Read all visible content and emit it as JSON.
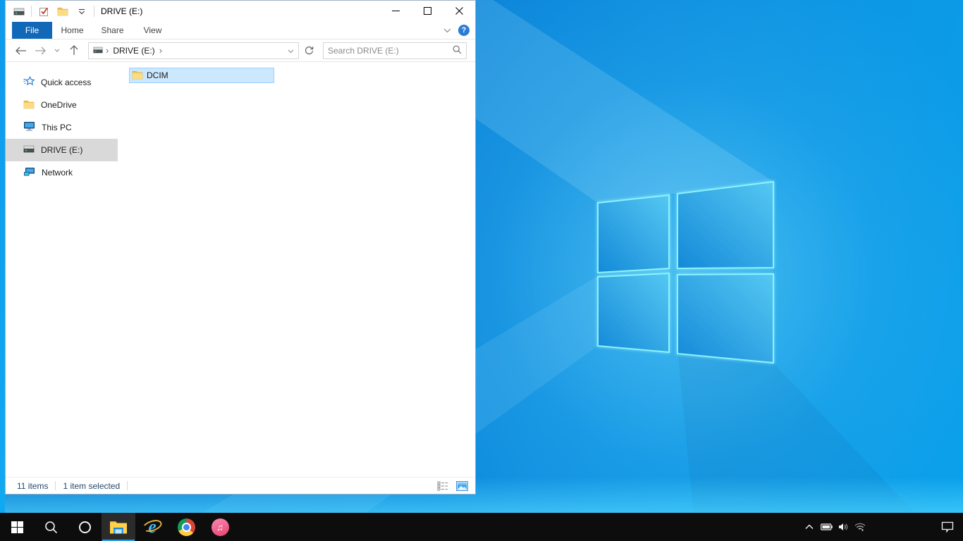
{
  "explorer": {
    "title": "DRIVE (E:)",
    "ribbon_tabs": [
      {
        "label": "File",
        "active": true
      },
      {
        "label": "Home",
        "active": false
      },
      {
        "label": "Share",
        "active": false
      },
      {
        "label": "View",
        "active": false
      }
    ],
    "breadcrumb": {
      "root_icon": "drive-icon",
      "segments": [
        "DRIVE (E:)"
      ]
    },
    "search_placeholder": "Search DRIVE (E:)",
    "sidebar_items": [
      {
        "label": "Quick access",
        "icon": "quick-access-star-icon",
        "selected": false
      },
      {
        "label": "OneDrive",
        "icon": "folder-icon",
        "selected": false
      },
      {
        "label": "This PC",
        "icon": "this-pc-icon",
        "selected": false
      },
      {
        "label": "DRIVE (E:)",
        "icon": "drive-icon",
        "selected": true
      },
      {
        "label": "Network",
        "icon": "network-icon",
        "selected": false
      }
    ],
    "files": [
      {
        "name": "DCIM",
        "icon": "folder-icon",
        "selected": true
      }
    ],
    "status_bar": {
      "items_count": "11 items",
      "selection": "1 item selected"
    },
    "help_icon": "?"
  },
  "taskbar": {
    "apps": [
      "start",
      "search",
      "cortana",
      "file-explorer",
      "internet-explorer",
      "chrome",
      "itunes"
    ],
    "active_app": "file-explorer",
    "tray_icons": [
      "hidden-icons-chevron",
      "battery",
      "volume",
      "wifi"
    ],
    "action_center": "action-center"
  },
  "colors": {
    "accent_blue": "#1168b8",
    "selection_fill": "#cce8ff",
    "selection_border": "#99d1ff",
    "sidebar_selected": "#d9d9d9",
    "status_text": "#26486b",
    "taskbar_bg": "#0d0d0d",
    "taskbar_active_underline": "#2b9ce0",
    "wallpaper_base": "#0c83d8",
    "wallpaper_glow": "#8df2fc"
  }
}
